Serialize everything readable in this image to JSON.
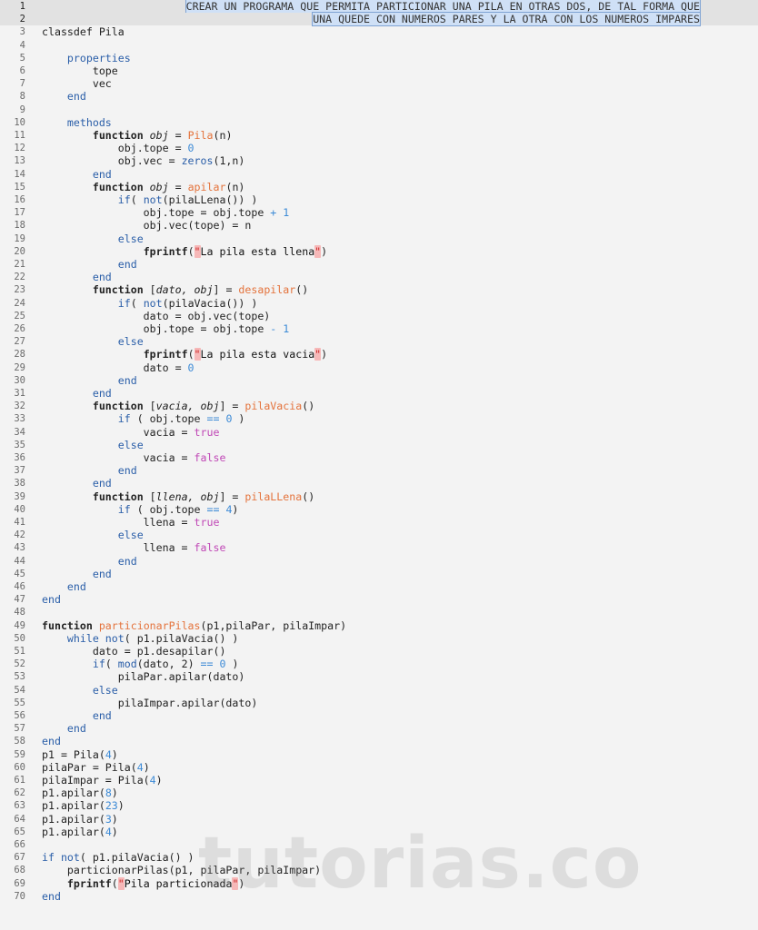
{
  "editor": {
    "lines": [
      [
        [
          "sel",
          "CREAR UN PROGRAMA QUE PERMITA PARTICIONAR UNA PILA EN OTRAS DOS, DE TAL FORMA QUE"
        ]
      ],
      [
        [
          "sel",
          "UNA QUEDE CON NUMEROS PARES Y LA OTRA CON LOS NUMEROS IMPARES"
        ]
      ],
      [
        [
          "t",
          "classdef Pila"
        ]
      ],
      [],
      [
        [
          "kw",
          "    properties"
        ]
      ],
      [
        [
          "t",
          "        tope"
        ]
      ],
      [
        [
          "t",
          "        vec"
        ]
      ],
      [
        [
          "kw",
          "    end"
        ]
      ],
      [],
      [
        [
          "kw",
          "    methods"
        ]
      ],
      [
        [
          "t",
          "        "
        ],
        [
          "kwb",
          "function "
        ],
        [
          "it",
          "obj"
        ],
        [
          "t",
          " = "
        ],
        [
          "fn",
          "Pila"
        ],
        [
          "t",
          "(n)"
        ]
      ],
      [
        [
          "t",
          "            obj.tope = "
        ],
        [
          "num",
          "0"
        ]
      ],
      [
        [
          "t",
          "            obj.vec = "
        ],
        [
          "kw",
          "zeros"
        ],
        [
          "t",
          "(1,n)"
        ]
      ],
      [
        [
          "kw",
          "        end"
        ]
      ],
      [
        [
          "t",
          "        "
        ],
        [
          "kwb",
          "function "
        ],
        [
          "it",
          "obj"
        ],
        [
          "t",
          " = "
        ],
        [
          "fn",
          "apilar"
        ],
        [
          "t",
          "(n)"
        ]
      ],
      [
        [
          "t",
          "            "
        ],
        [
          "kw",
          "if"
        ],
        [
          "t",
          "( "
        ],
        [
          "kw",
          "not"
        ],
        [
          "t",
          "(pilaLLena()) )"
        ]
      ],
      [
        [
          "t",
          "                obj.tope = obj.tope "
        ],
        [
          "num",
          "+ 1"
        ]
      ],
      [
        [
          "t",
          "                obj.vec(tope) = n"
        ]
      ],
      [
        [
          "kw",
          "            else"
        ]
      ],
      [
        [
          "t",
          "                "
        ],
        [
          "kwb",
          "fprintf"
        ],
        [
          "t",
          "("
        ],
        [
          "q",
          "\""
        ],
        [
          "str",
          "La pila esta llena"
        ],
        [
          "q",
          "\""
        ],
        [
          "t",
          ")"
        ]
      ],
      [
        [
          "kw",
          "            end"
        ]
      ],
      [
        [
          "kw",
          "        end"
        ]
      ],
      [
        [
          "t",
          "        "
        ],
        [
          "kwb",
          "function "
        ],
        [
          "t",
          "["
        ],
        [
          "it",
          "dato, obj"
        ],
        [
          "t",
          "] = "
        ],
        [
          "fn",
          "desapilar"
        ],
        [
          "t",
          "()"
        ]
      ],
      [
        [
          "t",
          "            "
        ],
        [
          "kw",
          "if"
        ],
        [
          "t",
          "( "
        ],
        [
          "kw",
          "not"
        ],
        [
          "t",
          "(pilaVacia()) )"
        ]
      ],
      [
        [
          "t",
          "                dato = obj.vec(tope)"
        ]
      ],
      [
        [
          "t",
          "                obj.tope = obj.tope "
        ],
        [
          "num",
          "- 1"
        ]
      ],
      [
        [
          "kw",
          "            else"
        ]
      ],
      [
        [
          "t",
          "                "
        ],
        [
          "kwb",
          "fprintf"
        ],
        [
          "t",
          "("
        ],
        [
          "q",
          "\""
        ],
        [
          "str",
          "La pila esta vacia"
        ],
        [
          "q",
          "\""
        ],
        [
          "t",
          ")"
        ]
      ],
      [
        [
          "t",
          "                dato = "
        ],
        [
          "num",
          "0"
        ]
      ],
      [
        [
          "kw",
          "            end"
        ]
      ],
      [
        [
          "kw",
          "        end"
        ]
      ],
      [
        [
          "t",
          "        "
        ],
        [
          "kwb",
          "function "
        ],
        [
          "t",
          "["
        ],
        [
          "it",
          "vacia, obj"
        ],
        [
          "t",
          "] = "
        ],
        [
          "fn",
          "pilaVacia"
        ],
        [
          "t",
          "()"
        ]
      ],
      [
        [
          "t",
          "            "
        ],
        [
          "kw",
          "if"
        ],
        [
          "t",
          " ( obj.tope "
        ],
        [
          "num",
          "== 0"
        ],
        [
          "t",
          " )"
        ]
      ],
      [
        [
          "t",
          "                vacia = "
        ],
        [
          "bool",
          "true"
        ]
      ],
      [
        [
          "kw",
          "            else"
        ]
      ],
      [
        [
          "t",
          "                vacia = "
        ],
        [
          "bool",
          "false"
        ]
      ],
      [
        [
          "kw",
          "            end"
        ]
      ],
      [
        [
          "kw",
          "        end"
        ]
      ],
      [
        [
          "t",
          "        "
        ],
        [
          "kwb",
          "function "
        ],
        [
          "t",
          "["
        ],
        [
          "it",
          "llena, obj"
        ],
        [
          "t",
          "] = "
        ],
        [
          "fn",
          "pilaLLena"
        ],
        [
          "t",
          "()"
        ]
      ],
      [
        [
          "t",
          "            "
        ],
        [
          "kw",
          "if"
        ],
        [
          "t",
          " ( obj.tope "
        ],
        [
          "num",
          "== 4"
        ],
        [
          "t",
          ")"
        ]
      ],
      [
        [
          "t",
          "                llena = "
        ],
        [
          "bool",
          "true"
        ]
      ],
      [
        [
          "kw",
          "            else"
        ]
      ],
      [
        [
          "t",
          "                llena = "
        ],
        [
          "bool",
          "false"
        ]
      ],
      [
        [
          "kw",
          "            end"
        ]
      ],
      [
        [
          "kw",
          "        end"
        ]
      ],
      [
        [
          "kw",
          "    end"
        ]
      ],
      [
        [
          "kw",
          "end"
        ]
      ],
      [],
      [
        [
          "kwb",
          "function "
        ],
        [
          "fn",
          "particionarPilas"
        ],
        [
          "t",
          "(p1,pilaPar, pilaImpar)"
        ]
      ],
      [
        [
          "t",
          "    "
        ],
        [
          "kw",
          "while not"
        ],
        [
          "t",
          "( p1.pilaVacia() )"
        ]
      ],
      [
        [
          "t",
          "        dato = p1.desapilar()"
        ]
      ],
      [
        [
          "t",
          "        "
        ],
        [
          "kw",
          "if"
        ],
        [
          "t",
          "( "
        ],
        [
          "kw",
          "mod"
        ],
        [
          "t",
          "(dato, 2) "
        ],
        [
          "num",
          "== 0"
        ],
        [
          "t",
          " )"
        ]
      ],
      [
        [
          "t",
          "            pilaPar.apilar(dato)"
        ]
      ],
      [
        [
          "kw",
          "        else"
        ]
      ],
      [
        [
          "t",
          "            pilaImpar.apilar(dato)"
        ]
      ],
      [
        [
          "kw",
          "        end"
        ]
      ],
      [
        [
          "kw",
          "    end"
        ]
      ],
      [
        [
          "kw",
          "end"
        ]
      ],
      [
        [
          "t",
          "p1 = Pila("
        ],
        [
          "num",
          "4"
        ],
        [
          "t",
          ")"
        ]
      ],
      [
        [
          "t",
          "pilaPar = Pila("
        ],
        [
          "num",
          "4"
        ],
        [
          "t",
          ")"
        ]
      ],
      [
        [
          "t",
          "pilaImpar = Pila("
        ],
        [
          "num",
          "4"
        ],
        [
          "t",
          ")"
        ]
      ],
      [
        [
          "t",
          "p1.apilar("
        ],
        [
          "num",
          "8"
        ],
        [
          "t",
          ")"
        ]
      ],
      [
        [
          "t",
          "p1.apilar("
        ],
        [
          "num",
          "23"
        ],
        [
          "t",
          ")"
        ]
      ],
      [
        [
          "t",
          "p1.apilar("
        ],
        [
          "num",
          "3"
        ],
        [
          "t",
          ")"
        ]
      ],
      [
        [
          "t",
          "p1.apilar("
        ],
        [
          "num",
          "4"
        ],
        [
          "t",
          ")"
        ]
      ],
      [],
      [
        [
          "kw",
          "if not"
        ],
        [
          "t",
          "( p1.pilaVacia() )"
        ]
      ],
      [
        [
          "t",
          "    particionarPilas(p1, pilaPar, pilaImpar)"
        ]
      ],
      [
        [
          "t",
          "    "
        ],
        [
          "kwb",
          "fprintf"
        ],
        [
          "t",
          "("
        ],
        [
          "q",
          "\""
        ],
        [
          "str",
          "Pila particionada"
        ],
        [
          "q",
          "\""
        ],
        [
          "t",
          ")"
        ]
      ],
      [
        [
          "kw",
          "end"
        ]
      ]
    ]
  },
  "watermark": "tutorias.co"
}
